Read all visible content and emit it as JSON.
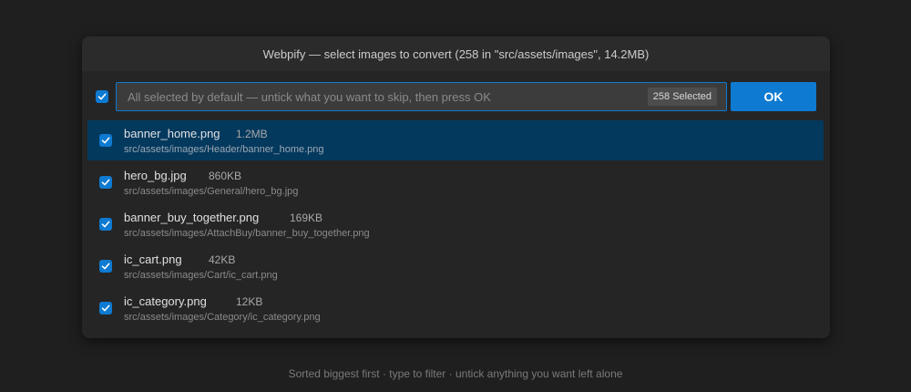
{
  "dialog": {
    "title": "Webpify — select images to convert (258 in \"src/assets/images\", 14.2MB)"
  },
  "input": {
    "placeholder": "All selected by default — untick what you want to skip, then press OK",
    "value": "",
    "selected_badge": "258 Selected",
    "select_all_checked": true
  },
  "ok_button": {
    "label": "OK"
  },
  "items": [
    {
      "name": "banner_home.png",
      "size": "1.2MB",
      "path": "src/assets/images/Header/banner_home.png",
      "checked": true,
      "highlighted": true
    },
    {
      "name": "hero_bg.jpg",
      "size": "860KB",
      "path": "src/assets/images/General/hero_bg.jpg",
      "checked": true,
      "highlighted": false
    },
    {
      "name": "banner_buy_together.png",
      "size": "169KB",
      "path": "src/assets/images/AttachBuy/banner_buy_together.png",
      "checked": true,
      "highlighted": false
    },
    {
      "name": "ic_cart.png",
      "size": "42KB",
      "path": "src/assets/images/Cart/ic_cart.png",
      "checked": true,
      "highlighted": false
    },
    {
      "name": "ic_category.png",
      "size": "12KB",
      "path": "src/assets/images/Category/ic_category.png",
      "checked": true,
      "highlighted": false
    }
  ],
  "footer": {
    "hint": "Sorted biggest first · type to filter · untick anything you want left alone"
  },
  "colors": {
    "accent": "#0e7ad1",
    "highlight_row": "#04395e",
    "panel_bg": "#252526",
    "page_bg": "#1f1f1f"
  }
}
